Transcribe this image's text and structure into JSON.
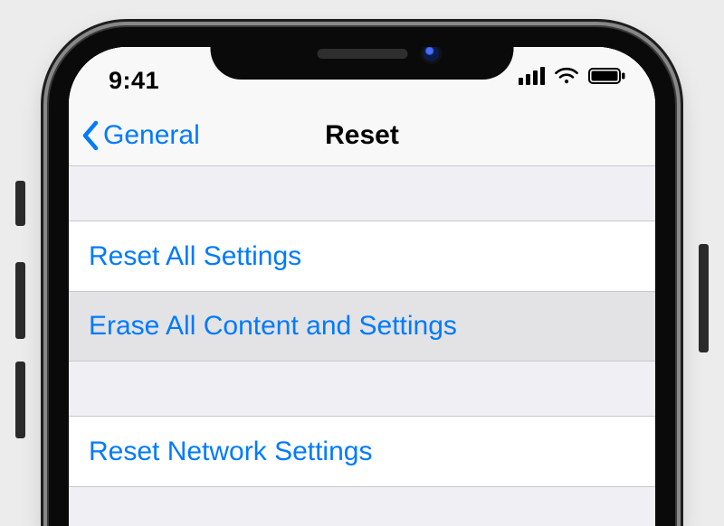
{
  "status": {
    "time": "9:41"
  },
  "nav": {
    "back_label": "General",
    "title": "Reset"
  },
  "list": {
    "group1": {
      "row0": "Reset All Settings",
      "row1": "Erase All Content and Settings"
    },
    "group2": {
      "row0": "Reset Network Settings"
    }
  },
  "colors": {
    "accent": "#007aff"
  }
}
